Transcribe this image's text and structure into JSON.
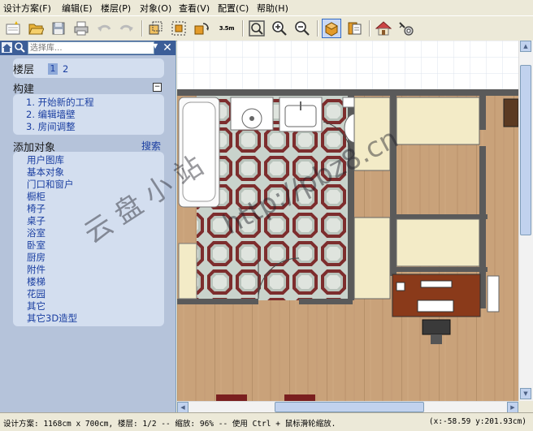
{
  "menu": [
    "设计方案(F)",
    "编辑(E)",
    "楼层(P)",
    "对象(O)",
    "查看(V)",
    "配置(C)",
    "帮助(H)"
  ],
  "toolbar": {
    "buttons": [
      "new-icon",
      "open-icon",
      "save-icon",
      "print-icon",
      "undo-icon",
      "redo-icon",
      "add-level-icon",
      "select-icon",
      "rotate-icon",
      "measure-icon",
      "zoom-fit-icon",
      "zoom-in-icon",
      "zoom-out-icon",
      "view-3d-icon",
      "view-2d-icon",
      "house-icon",
      "settings-icon"
    ],
    "measure_label": "3.5m",
    "active": "view-3d-icon"
  },
  "search": {
    "placeholder": "选择库..."
  },
  "left_panel": {
    "floors": {
      "title": "楼层",
      "items": [
        "1",
        "2"
      ],
      "selected": "1"
    },
    "build": {
      "title": "构建",
      "items": [
        "1. 开始新的工程",
        "2. 编辑墙壁",
        "3. 房间调整"
      ]
    },
    "add_objects": {
      "title": "添加对象",
      "search_label": "搜索",
      "items": [
        "用户图库",
        "基本对象",
        "门口和窗户",
        "橱柜",
        "椅子",
        "桌子",
        "浴室",
        "卧室",
        "厨房",
        "附件",
        "楼梯",
        "花园",
        "其它",
        "其它3D造型"
      ]
    }
  },
  "watermark": {
    "text1": "云盘小站",
    "text2": "http://pbz8.cn"
  },
  "status": {
    "left": "设计方案: 1168cm x 700cm, 楼层: 1/2 -- 缩放: 96% -- 使用 Ctrl + 鼠标滑轮缩放.",
    "right": "(x:-58.59 y:201.93cm)"
  },
  "colors": {
    "panel_bg": "#b5c3da",
    "panel_section": "#d3deef",
    "link": "#1a3ea1",
    "header_bar": "#3c5e98",
    "wall": "#5a5a5a",
    "wood": "#c9a27a"
  }
}
